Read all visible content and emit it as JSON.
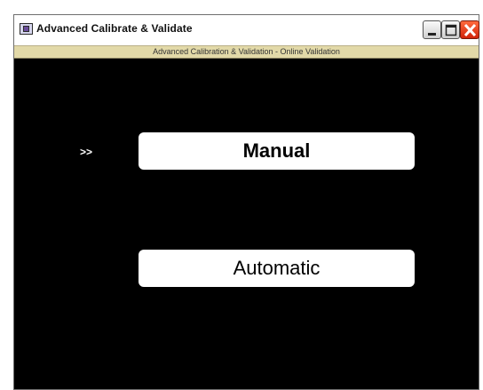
{
  "window": {
    "title": "Advanced Calibrate & Validate",
    "subtitle": "Advanced Calibration & Validation - Online Validation"
  },
  "main": {
    "selection_indicator": ">>",
    "manual_label": "Manual",
    "automatic_label": "Automatic"
  },
  "icons": {
    "app": "app-icon",
    "minimize": "minimize-icon",
    "maximize": "maximize-icon",
    "close": "close-icon"
  }
}
